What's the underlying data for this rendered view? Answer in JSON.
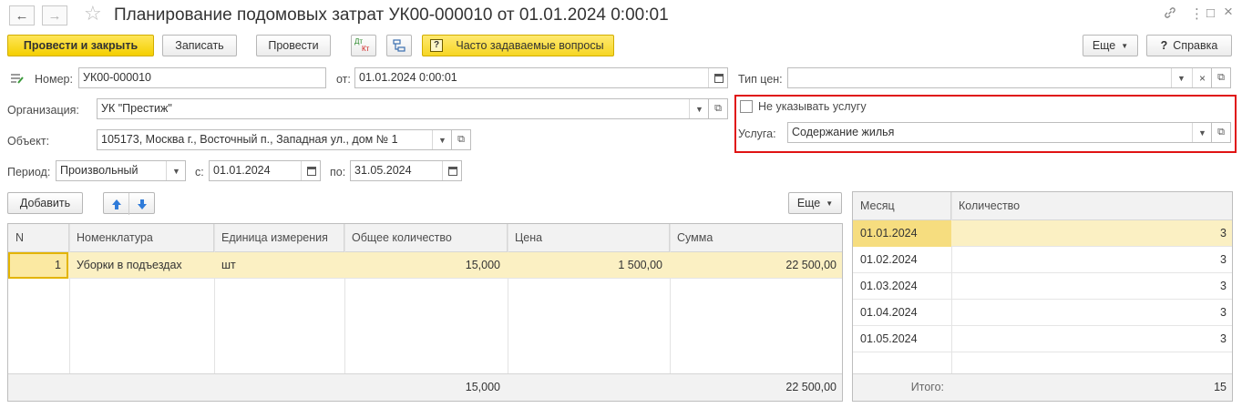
{
  "window": {
    "title": "Планирование подомовых затрат УК00-000010 от 01.01.2024 0:00:01",
    "back_icon": "←",
    "forward_icon": "→",
    "favorite_icon": "☆",
    "link_icon": "🔗",
    "menu_icon": "⋮",
    "maximize_icon": "□",
    "close_icon": "×"
  },
  "toolbar": {
    "post_close_label": "Провести и закрыть",
    "save_label": "Записать",
    "post_label": "Провести",
    "dtkt_top": "Дт",
    "dtkt_bottom": "Кт",
    "faq_label": "Часто задаваемые вопросы",
    "more_label": "Еще",
    "help_label": "Справка",
    "help_icon": "?"
  },
  "form": {
    "number_label": "Номер:",
    "number_value": "УК00-000010",
    "date_label": "от:",
    "date_value": "01.01.2024  0:00:01",
    "org_label": "Организация:",
    "org_value": "УК \"Престиж\"",
    "object_label": "Объект:",
    "object_value": "105173, Москва г., Восточный п., Западная ул., дом № 1",
    "period_label": "Период:",
    "period_value": "Произвольный",
    "from_label": "с:",
    "from_value": "01.01.2024",
    "to_label": "по:",
    "to_value": "31.05.2024",
    "price_type_label": "Тип цен:",
    "price_type_value": "",
    "no_service_label": "Не указывать услугу",
    "service_label": "Услуга:",
    "service_value": "Содержание жилья"
  },
  "table_toolbar": {
    "add_label": "Добавить",
    "up_icon": "🡅",
    "down_icon": "🡇",
    "more_label": "Еще"
  },
  "main_table": {
    "columns": [
      "N",
      "Номенклатура",
      "Единица измерения",
      "Общее количество",
      "Цена",
      "Сумма"
    ],
    "rows": [
      {
        "n": "1",
        "item": "Уборки в подъездах",
        "unit": "шт",
        "qty": "15,000",
        "price": "1 500,00",
        "sum": "22 500,00"
      }
    ],
    "footer": {
      "qty": "15,000",
      "sum": "22 500,00"
    }
  },
  "month_table": {
    "columns": [
      "Месяц",
      "Количество"
    ],
    "rows": [
      {
        "month": "01.01.2024",
        "qty": "3"
      },
      {
        "month": "01.02.2024",
        "qty": "3"
      },
      {
        "month": "01.03.2024",
        "qty": "3"
      },
      {
        "month": "01.04.2024",
        "qty": "3"
      },
      {
        "month": "01.05.2024",
        "qty": "3"
      }
    ],
    "footer": {
      "label": "Итого:",
      "qty": "15"
    }
  },
  "colors": {
    "accent_yellow": "#f4cf00",
    "highlight_red": "#e01313",
    "selected_row": "#fbf0c3",
    "arrow_blue": "#2f7bd9"
  }
}
